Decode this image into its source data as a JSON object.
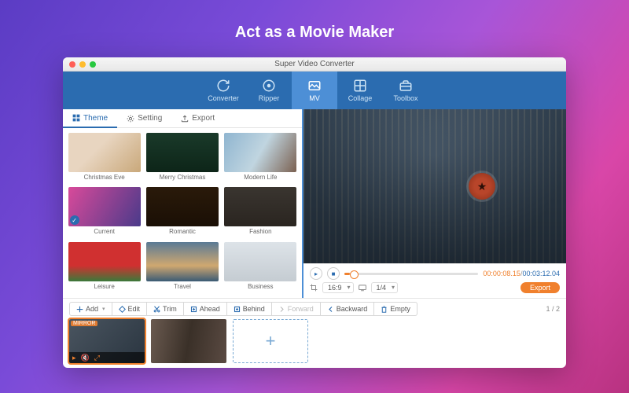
{
  "hero_title": "Act as a Movie Maker",
  "window_title": "Super Video Converter",
  "toolbar": [
    {
      "key": "converter",
      "label": "Converter"
    },
    {
      "key": "ripper",
      "label": "Ripper"
    },
    {
      "key": "mv",
      "label": "MV"
    },
    {
      "key": "collage",
      "label": "Collage"
    },
    {
      "key": "toolbox",
      "label": "Toolbox"
    }
  ],
  "subtabs": {
    "theme": "Theme",
    "setting": "Setting",
    "export": "Export"
  },
  "themes": [
    "Christmas Eve",
    "Merry Christmas",
    "Modern Life",
    "Current",
    "Romantic",
    "Fashion",
    "Leisure",
    "Travel",
    "Business"
  ],
  "player": {
    "aspect": "16:9",
    "scale": "1/4",
    "time_current": "00:00:08.15",
    "time_duration": "00:03:12.04",
    "export_label": "Export"
  },
  "actions": {
    "add": "Add",
    "edit": "Edit",
    "trim": "Trim",
    "ahead": "Ahead",
    "behind": "Behind",
    "forward": "Forward",
    "backward": "Backward",
    "empty": "Empty"
  },
  "page_indicator": "1 / 2",
  "clip_badge": "MIRROR"
}
